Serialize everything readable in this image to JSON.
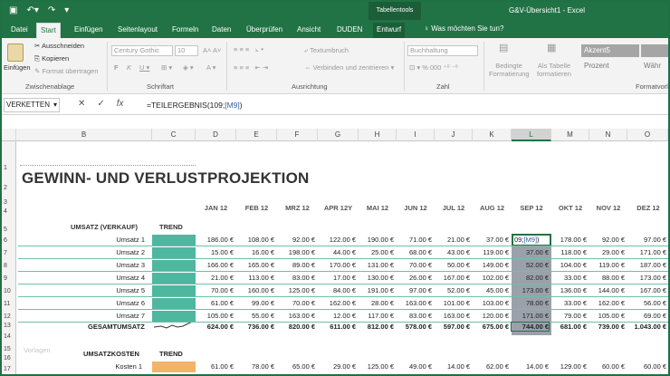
{
  "window": {
    "title": "G&V-Übersicht1  -  Excel",
    "context_tab_group": "Tabellentools",
    "qat_icons": [
      "save-icon",
      "undo-icon",
      "redo-icon",
      "customize-icon"
    ]
  },
  "tabs": [
    "Datei",
    "Start",
    "Einfügen",
    "Seitenlayout",
    "Formeln",
    "Daten",
    "Überprüfen",
    "Ansicht",
    "DUDEN",
    "Entwurf"
  ],
  "active_tab": "Start",
  "tell_me": "Was möchten Sie tun?",
  "ribbon": {
    "paste": "Einfügen",
    "cut": "Ausschneiden",
    "copy": "Kopieren",
    "format_painter": "Format übertragen",
    "clipboard_label": "Zwischenablage",
    "font_name": "Century Gothic",
    "font_size": "10",
    "font_label": "Schriftart",
    "wrap_text": "Textumbruch",
    "merge_center": "Verbinden und zentrieren",
    "alignment_label": "Ausrichtung",
    "number_format": "Buchhaltung",
    "number_label": "Zahl",
    "conditional_formatting": "Bedingte Formatierung",
    "format_as_table": "Als Tabelle formatieren",
    "style_accent": "Akzent5",
    "style_percent": "Prozent",
    "style_currency": "Währ",
    "styles_label": "Formatvorl"
  },
  "formula_bar": {
    "name_box": "VERKETTEN",
    "formula_prefix": "=TEILERGEBNIS(109;",
    "formula_ref": "[M9]",
    "formula_suffix": ")"
  },
  "columns": [
    "A",
    "B",
    "C",
    "D",
    "E",
    "F",
    "G",
    "H",
    "I",
    "J",
    "K",
    "L",
    "M",
    "N",
    "O"
  ],
  "selected_column": "L",
  "rows": [
    "1",
    "2",
    "3",
    "4",
    "5",
    "6",
    "7",
    "8",
    "9",
    "10",
    "11",
    "12",
    "13",
    "14",
    "15",
    "16",
    "17"
  ],
  "sheet": {
    "title": "GEWINN- UND VERLUSTPROJEKTION",
    "months": [
      "JAN 12",
      "FEB 12",
      "MRZ 12",
      "APR 12Y",
      "MAI 12",
      "JUN 12",
      "JUL 12",
      "AUG 12",
      "SEP 12",
      "OKT 12",
      "NOV 12",
      "DEZ 12"
    ],
    "sales_header": "UMSATZ (VERKAUF)",
    "trend_header": "TREND",
    "sales_rows": [
      {
        "label": "Umsatz 1",
        "values": [
          "186.00 €",
          "108.00 €",
          "92.00 €",
          "122.00 €",
          "190.00 €",
          "71.00 €",
          "21.00 €",
          "37.00 €",
          "",
          "178.00 €",
          "92.00 €",
          "97.00 €"
        ]
      },
      {
        "label": "Umsatz 2",
        "values": [
          "15.00 €",
          "16.00 €",
          "198.00 €",
          "44.00 €",
          "25.00 €",
          "68.00 €",
          "43.00 €",
          "119.00 €",
          "37.00 €",
          "118.00 €",
          "29.00 €",
          "171.00 €"
        ]
      },
      {
        "label": "Umsatz 3",
        "values": [
          "166.00 €",
          "165.00 €",
          "89.00 €",
          "170.00 €",
          "131.00 €",
          "70.00 €",
          "50.00 €",
          "149.00 €",
          "52.00 €",
          "104.00 €",
          "119.00 €",
          "187.00 €"
        ]
      },
      {
        "label": "Umsatz 4",
        "values": [
          "21.00 €",
          "113.00 €",
          "83.00 €",
          "17.00 €",
          "130.00 €",
          "26.00 €",
          "167.00 €",
          "102.00 €",
          "82.00 €",
          "33.00 €",
          "88.00 €",
          "173.00 €"
        ]
      },
      {
        "label": "Umsatz 5",
        "values": [
          "70.00 €",
          "160.00 €",
          "125.00 €",
          "84.00 €",
          "191.00 €",
          "97.00 €",
          "52.00 €",
          "45.00 €",
          "173.00 €",
          "136.00 €",
          "144.00 €",
          "167.00 €"
        ]
      },
      {
        "label": "Umsatz 6",
        "values": [
          "61.00 €",
          "99.00 €",
          "70.00 €",
          "162.00 €",
          "28.00 €",
          "163.00 €",
          "101.00 €",
          "103.00 €",
          "78.00 €",
          "33.00 €",
          "162.00 €",
          "56.00 €"
        ]
      },
      {
        "label": "Umsatz 7",
        "values": [
          "105.00 €",
          "55.00 €",
          "163.00 €",
          "12.00 €",
          "117.00 €",
          "83.00 €",
          "163.00 €",
          "120.00 €",
          "171.00 €",
          "79.00 €",
          "105.00 €",
          "69.00 €"
        ]
      }
    ],
    "active_cell_text_prefix": "09;",
    "active_cell_text_ref": "[M9]",
    "active_cell_text_suffix": ")",
    "total_label": "GESAMTUMSATZ",
    "total_values": [
      "624.00 €",
      "736.00 €",
      "820.00 €",
      "611.00 €",
      "812.00 €",
      "578.00 €",
      "597.00 €",
      "675.00 €",
      "744.00 €",
      "681.00 €",
      "739.00 €",
      "1.043.00 €"
    ],
    "ghost_text": "Vorlagen",
    "cost_header": "UMSATZKOSTEN",
    "cost_trend_header": "TREND",
    "cost_rows": [
      {
        "label": "Kosten 1",
        "values": [
          "61.00 €",
          "78.00 €",
          "65.00 €",
          "29.00 €",
          "125.00 €",
          "49.00 €",
          "14.00 €",
          "62.00 €",
          "14.00 €",
          "129.00 €",
          "60.00 €",
          "60.00 €"
        ]
      }
    ]
  },
  "colors": {
    "excel_green": "#217346",
    "sparkline_teal": "#4eb7a0",
    "sparkline_orange": "#f2b36b",
    "style_accent5": "#a5a5a5"
  }
}
